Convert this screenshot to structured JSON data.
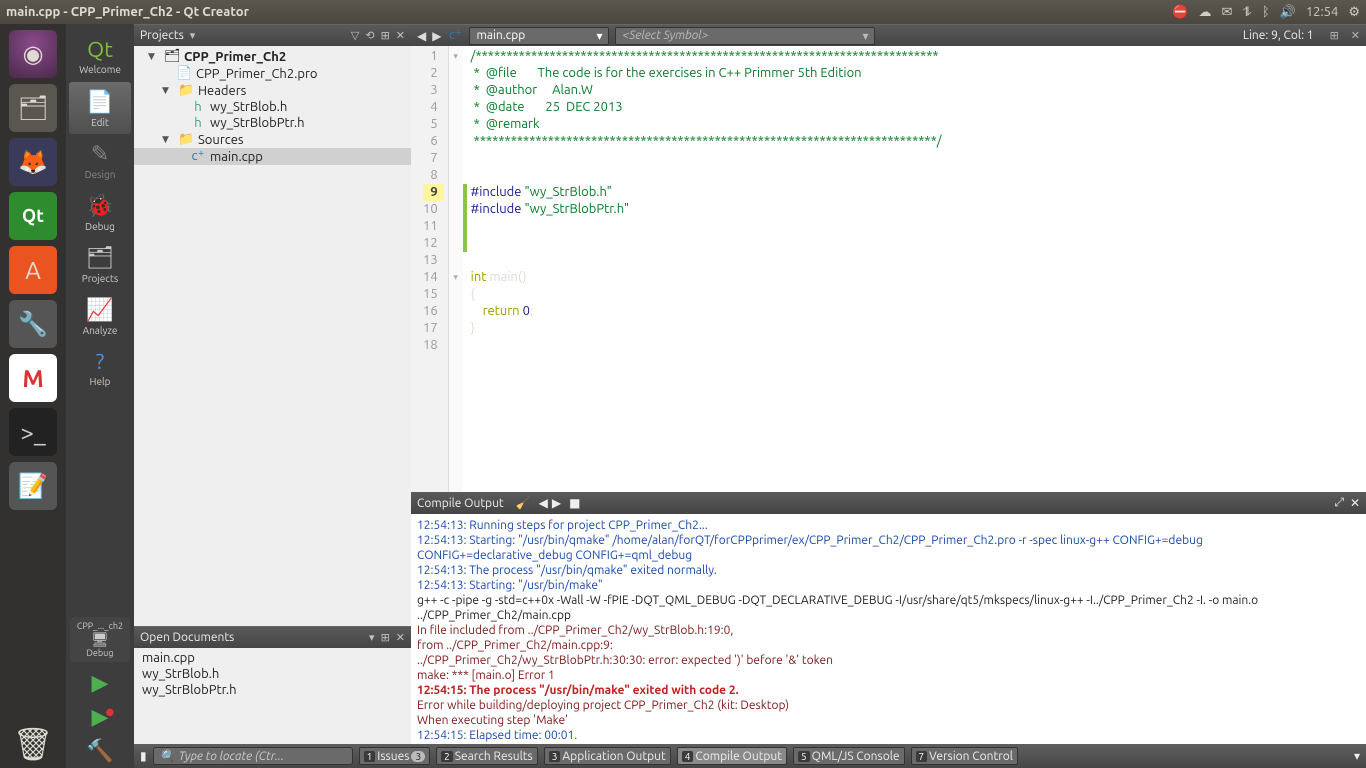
{
  "window": {
    "title": "main.cpp - CPP_Primer_Ch2 - Qt Creator"
  },
  "tray": {
    "time": "12:54"
  },
  "modes": {
    "welcome": "Welcome",
    "edit": "Edit",
    "design": "Design",
    "debug": "Debug",
    "projects": "Projects",
    "analyze": "Analyze",
    "help": "Help"
  },
  "kit": {
    "project": "CPP_..._ch2",
    "config": "Debug"
  },
  "projects_panel": {
    "title": "Projects",
    "tree": {
      "root": "CPP_Primer_Ch2",
      "pro": "CPP_Primer_Ch2.pro",
      "headers": "Headers",
      "h1": "wy_StrBlob.h",
      "h2": "wy_StrBlobPtr.h",
      "sources": "Sources",
      "s1": "main.cpp"
    }
  },
  "open_docs": {
    "title": "Open Documents",
    "d1": "main.cpp",
    "d2": "wy_StrBlob.h",
    "d3": "wy_StrBlobPtr.h"
  },
  "editor": {
    "file": "main.cpp",
    "symbol": "<Select Symbol>",
    "cursor": "Line: 9, Col: 1",
    "lines": {
      "l1": "/***************************************************************************",
      "l2": " *  @file       The code is for the exercises in C++ Primmer 5th Edition",
      "l3": " *  @author     Alan.W",
      "l4": " *  @date       25  DEC 2013",
      "l5": " *  @remark",
      "l6": " ***************************************************************************/",
      "l7": "",
      "l8": "",
      "l9_pp": "#include ",
      "l9_str": "\"wy_StrBlob.h\"",
      "l10_pp": "#include ",
      "l10_str": "\"wy_StrBlobPtr.h\"",
      "l11": "",
      "l12": "",
      "l13": "",
      "l14_kw": "int",
      "l14_rest": " main()",
      "l15": "{",
      "l16_a": "    ",
      "l16_kw": "return",
      "l16_b": " ",
      "l16_num": "0",
      "l16_c": ";",
      "l17": "}",
      "l18": ""
    }
  },
  "compile": {
    "title": "Compile Output",
    "c1": "12:54:13: Running steps for project CPP_Primer_Ch2...",
    "c2": "12:54:13: Starting: \"/usr/bin/qmake\" /home/alan/forQT/forCPPprimer/ex/CPP_Primer_Ch2/CPP_Primer_Ch2.pro -r -spec linux-g++ CONFIG+=debug CONFIG+=declarative_debug CONFIG+=qml_debug",
    "c3": "12:54:13: The process \"/usr/bin/qmake\" exited normally.",
    "c4": "12:54:13: Starting: \"/usr/bin/make\"",
    "c5": "g++ -c -pipe -g -std=c++0x -Wall -W -fPIE -DQT_QML_DEBUG -DQT_DECLARATIVE_DEBUG -I/usr/share/qt5/mkspecs/linux-g++ -I../CPP_Primer_Ch2 -I. -o main.o ../CPP_Primer_Ch2/main.cpp",
    "c6": "In file included from ../CPP_Primer_Ch2/wy_StrBlob.h:19:0,",
    "c7": "                 from ../CPP_Primer_Ch2/main.cpp:9:",
    "c8": "../CPP_Primer_Ch2/wy_StrBlobPtr.h:30:30: error: expected ')' before '&' token",
    "c9": "make: *** [main.o] Error 1",
    "c10": "12:54:15: The process \"/usr/bin/make\" exited with code 2.",
    "c11": "Error while building/deploying project CPP_Primer_Ch2 (kit: Desktop)",
    "c12": "When executing step 'Make'",
    "c13": "12:54:15: Elapsed time: 00:01."
  },
  "bottom": {
    "locator_ph": "Type to locate (Ctr...",
    "tabs": {
      "t1": "Issues",
      "t1b": "3",
      "t2": "Search Results",
      "t3": "Application Output",
      "t4": "Compile Output",
      "t5": "QML/JS Console",
      "t7": "Version Control"
    }
  }
}
